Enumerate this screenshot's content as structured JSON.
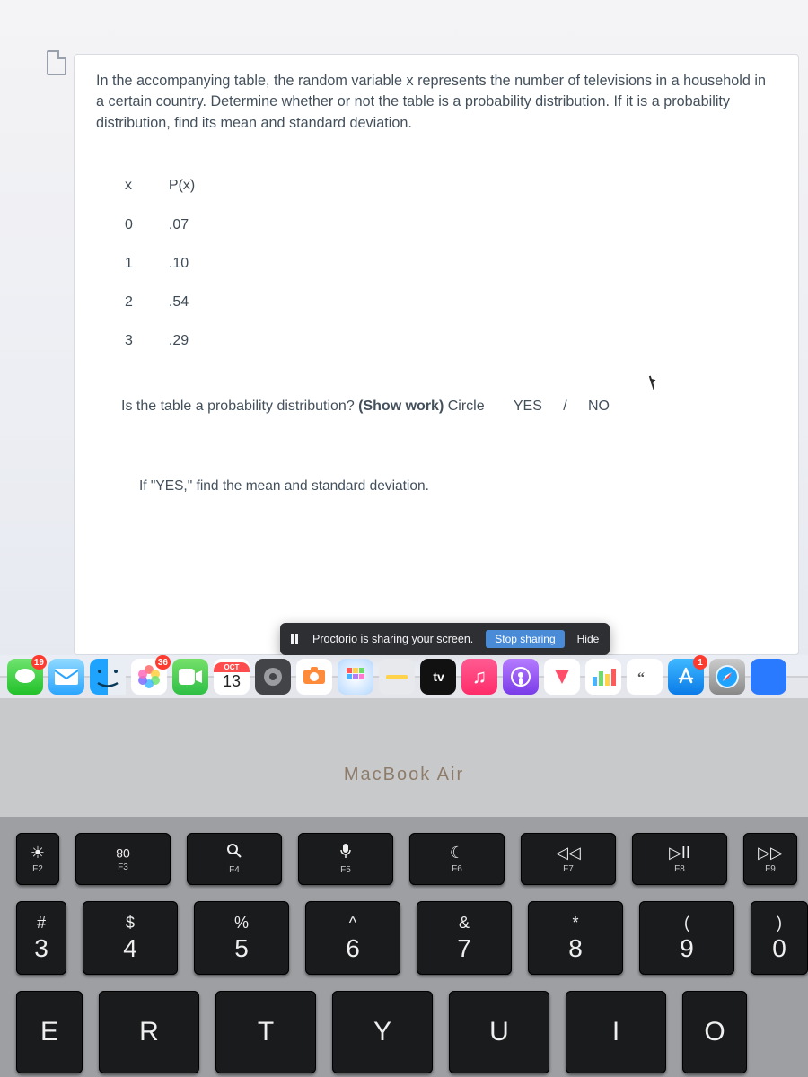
{
  "question": {
    "prompt": "In the accompanying table, the random variable x represents the number of televisions in a household in a certain country. Determine whether or not the table is a probability distribution. If it is a probability distribution, find its mean and standard deviation.",
    "headers": {
      "x": "x",
      "p": "P(x)"
    },
    "rows": [
      {
        "x": "0",
        "p": ".07"
      },
      {
        "x": "1",
        "p": ".10"
      },
      {
        "x": "2",
        "p": ".54"
      },
      {
        "x": "3",
        "p": ".29"
      }
    ],
    "sub1_pre": "Is the table a probability distribution? ",
    "sub1_show": "(Show work)",
    "sub1_circle": "  Circle",
    "yes": "YES",
    "slash": "/",
    "no": "NO",
    "sub2": "If \"YES,\" find the mean and standard deviation."
  },
  "banner": {
    "text": "Proctorio is sharing your screen.",
    "stop": "Stop sharing",
    "hide": "Hide"
  },
  "dock": {
    "messages_badge": "19",
    "photos_badge": "36",
    "cal_month": "OCT",
    "cal_day": "13",
    "tv_label": " tv",
    "appstore_badge": "1"
  },
  "laptop_label": "MacBook Air",
  "keyboard": {
    "fn": [
      {
        "sym": "☀",
        "label": "F2"
      },
      {
        "sym": "▦",
        "label": "F3",
        "flip": "80"
      },
      {
        "sym": "Q",
        "label": "F4",
        "search": true
      },
      {
        "sym": "⚙",
        "label": "F5",
        "mic": true
      },
      {
        "sym": "☾",
        "label": "F6"
      },
      {
        "sym": "⏪",
        "label": "F7"
      },
      {
        "sym": "⏯",
        "label": "F8"
      },
      {
        "sym": "⏩",
        "label": "F9"
      }
    ],
    "numrow": [
      {
        "upper": "#",
        "lower": "3"
      },
      {
        "upper": "$",
        "lower": "4"
      },
      {
        "upper": "%",
        "lower": "5"
      },
      {
        "upper": "^",
        "lower": "6"
      },
      {
        "upper": "&",
        "lower": "7"
      },
      {
        "upper": "*",
        "lower": "8"
      },
      {
        "upper": "(",
        "lower": "9"
      },
      {
        "upper": ")",
        "lower": "0"
      }
    ],
    "letters": [
      "E",
      "R",
      "T",
      "Y",
      "U",
      "I",
      "O"
    ]
  }
}
